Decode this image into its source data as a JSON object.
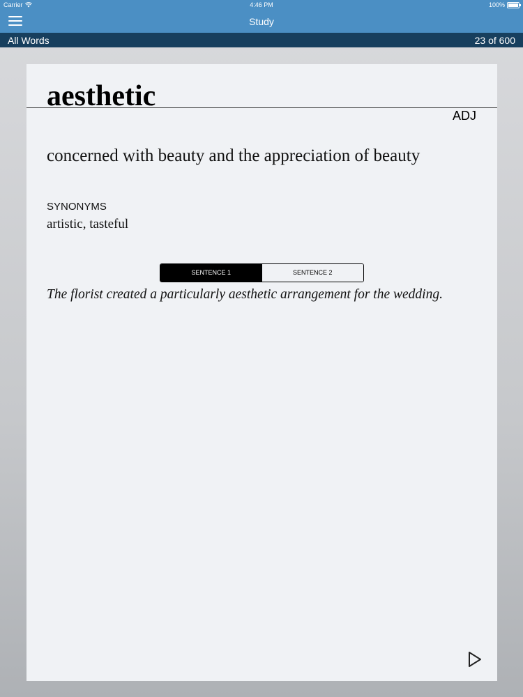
{
  "status_bar": {
    "carrier": "Carrier",
    "time": "4:46 PM",
    "battery": "100%"
  },
  "nav": {
    "title": "Study",
    "menu_icon": "hamburger-menu-icon"
  },
  "sub_bar": {
    "list_name": "All Words",
    "counter": "23 of 600"
  },
  "card": {
    "word": "aesthetic",
    "part_of_speech": "ADJ",
    "definition": "concerned with beauty and the appreciation of beauty",
    "synonyms_heading": "SYNONYMS",
    "synonyms": "artistic, tasteful",
    "segments": [
      {
        "label": "SENTENCE 1",
        "selected": true
      },
      {
        "label": "SENTENCE 2",
        "selected": false
      }
    ],
    "sentence": "The florist created a particularly aesthetic arrangement for the wedding.",
    "play_icon": "play-icon"
  }
}
